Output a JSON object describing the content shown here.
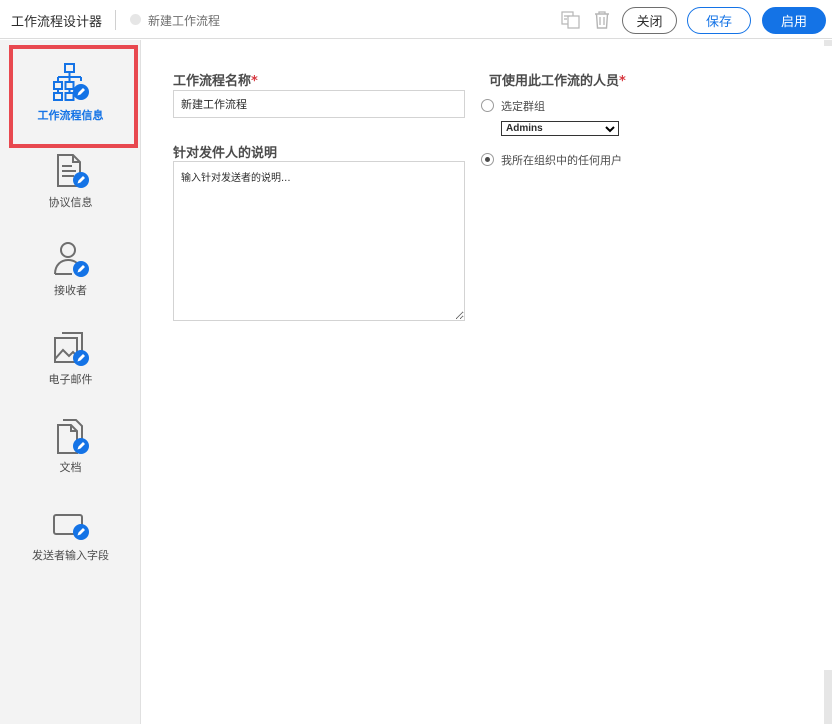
{
  "header": {
    "app_title": "工作流程设计器",
    "workflow_name": "新建工作流程",
    "copy_icon": "copy-icon",
    "trash_icon": "trash-icon",
    "close_label": "关闭",
    "save_label": "保存",
    "enable_label": "启用"
  },
  "sidebar": {
    "items": [
      {
        "label": "工作流程信息",
        "icon": "workflow-icon",
        "active": true
      },
      {
        "label": "协议信息",
        "icon": "agreement-icon",
        "active": false
      },
      {
        "label": "接收者",
        "icon": "recipient-icon",
        "active": false
      },
      {
        "label": "电子邮件",
        "icon": "email-icon",
        "active": false
      },
      {
        "label": "文档",
        "icon": "document-icon",
        "active": false
      },
      {
        "label": "发送者输入字段",
        "icon": "sender-field-icon",
        "active": false
      }
    ]
  },
  "form": {
    "name_label": "工作流程名称",
    "name_value": "新建工作流程",
    "instructions_label": "针对发件人的说明",
    "instructions_placeholder": "输入针对发送者的说明...",
    "who_label": "可使用此工作流的人员",
    "required_mark": "*",
    "option_group_label": "选定群组",
    "group_selected": "Admins",
    "option_anyone_label": "我所在组织中的任何用户",
    "selected_option": "anyone"
  },
  "colors": {
    "accent": "#1473e6",
    "highlight": "#e8484f"
  }
}
